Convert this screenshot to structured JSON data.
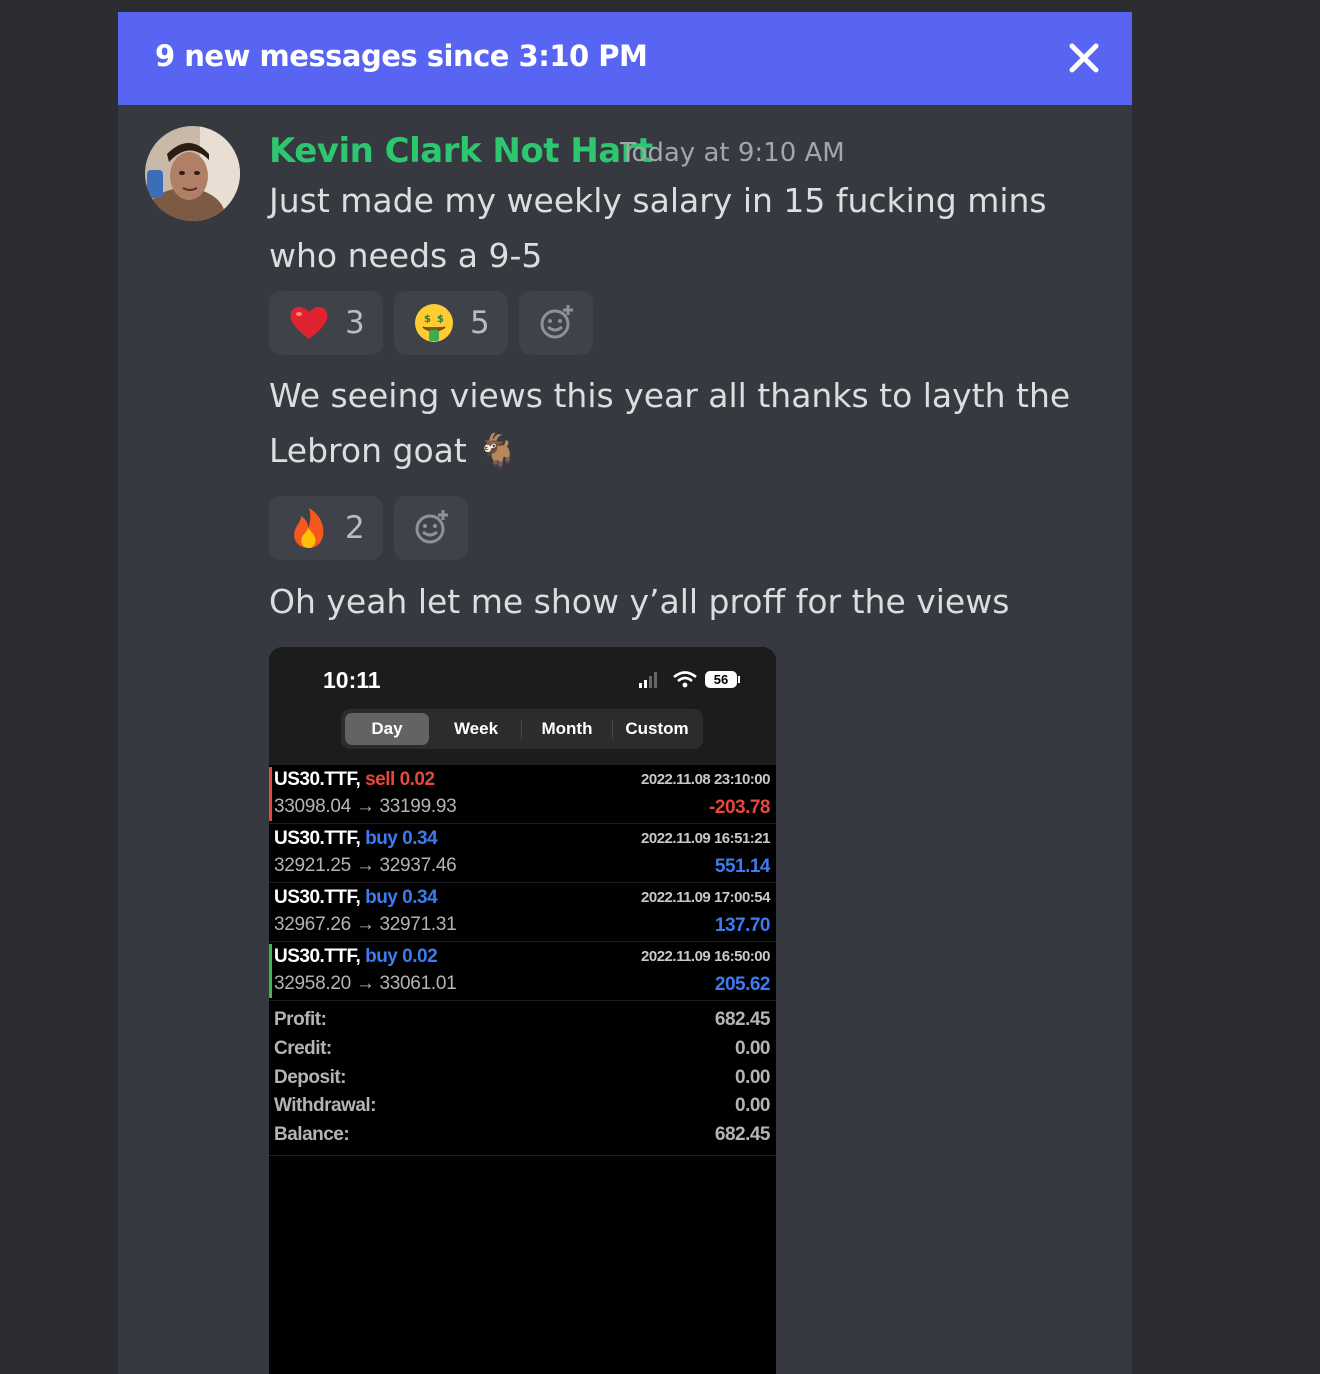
{
  "banner": {
    "text": "9 new messages since 3:10 PM",
    "close_icon": "close-icon"
  },
  "message": {
    "author": "Kevin Clark Not Hart",
    "timestamp": "Today at 9:10 AM",
    "author_color": "#2dc770",
    "lines": [
      "Just made my weekly salary in 15 fucking mins who needs a 9-5",
      "We seeing views this year all thanks to layth the Lebron goat 🐐",
      "Oh yeah let me show y’all proff for the views"
    ]
  },
  "reactions_1": [
    {
      "emoji": "heart-icon",
      "count": "3"
    },
    {
      "emoji": "money-mouth-face-icon",
      "count": "5"
    }
  ],
  "reactions_2": [
    {
      "emoji": "fire-icon",
      "count": "2"
    }
  ],
  "screenshot": {
    "time": "10:11",
    "battery": "56",
    "tabs": [
      "Day",
      "Week",
      "Month",
      "Custom"
    ],
    "active_tab": "Day",
    "trades": [
      {
        "symbol": "US30.TTF,",
        "side": "sell 0.02",
        "prices": "33098.04 → 33199.93",
        "date": "2022.11.08 23:10:00",
        "result": "-203.78"
      },
      {
        "symbol": "US30.TTF,",
        "side": "buy 0.34",
        "prices": "32921.25 → 32937.46",
        "date": "2022.11.09 16:51:21",
        "result": "551.14"
      },
      {
        "symbol": "US30.TTF,",
        "side": "buy 0.34",
        "prices": "32967.26 → 32971.31",
        "date": "2022.11.09 17:00:54",
        "result": "137.70"
      },
      {
        "symbol": "US30.TTF,",
        "side": "buy 0.02",
        "prices": "32958.20 → 33061.01",
        "date": "2022.11.09 16:50:00",
        "result": "205.62"
      }
    ],
    "summary": [
      {
        "label": "Profit:",
        "value": "682.45"
      },
      {
        "label": "Credit:",
        "value": "0.00"
      },
      {
        "label": "Deposit:",
        "value": "0.00"
      },
      {
        "label": "Withdrawal:",
        "value": "0.00"
      },
      {
        "label": "Balance:",
        "value": "682.45"
      }
    ],
    "colors": {
      "sell": "#e5483c",
      "buy": "#3d7bf0",
      "loss": "#e5483c",
      "profit": "#3d7bf0"
    }
  }
}
